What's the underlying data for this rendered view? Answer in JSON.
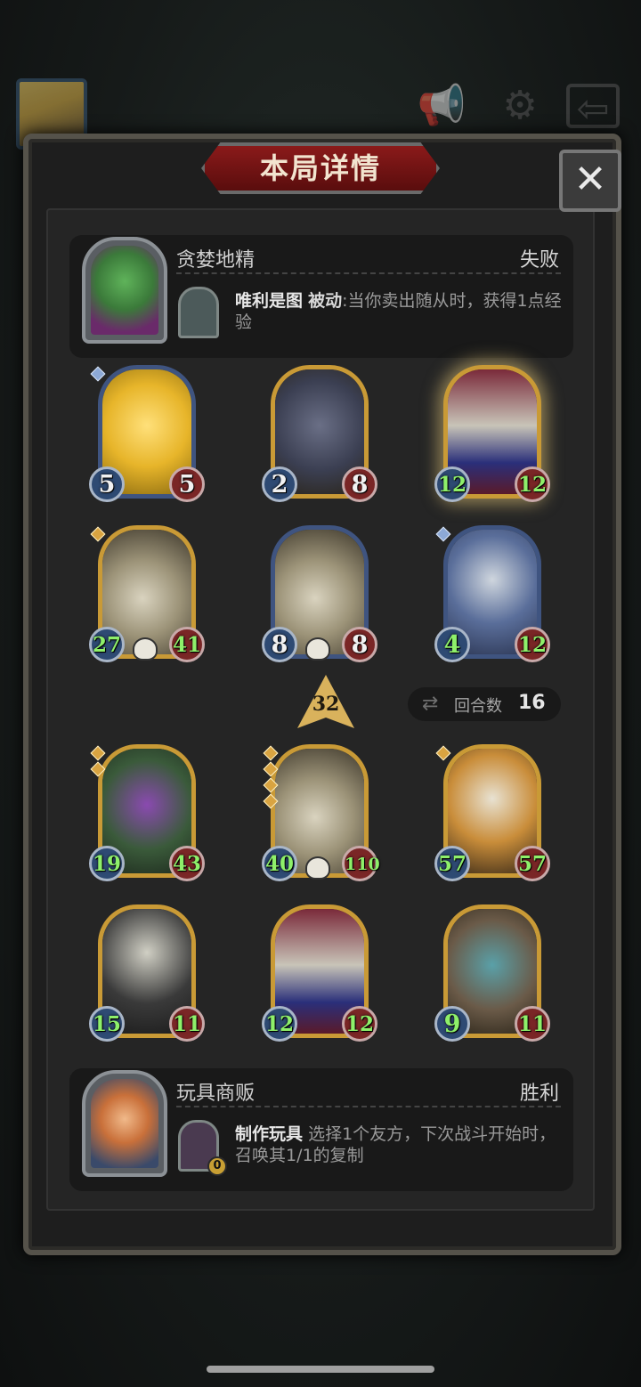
{
  "dialog": {
    "title": "本局详情",
    "close_label": "✕"
  },
  "opponent": {
    "name": "贪婪地精",
    "result": "失败",
    "skill_name": "唯利是图",
    "skill_type": "被动",
    "skill_desc": ":当你卖出随从时，获得1点经验"
  },
  "self": {
    "name": "玩具商贩",
    "result": "胜利",
    "skill_name": "制作玩具",
    "skill_desc": "选择1个友方，下次战斗开始时，召唤其1/1的复制",
    "skill_counter": "0"
  },
  "opponent_minions": [
    {
      "name": "golden-dragon",
      "atk": "5",
      "hp": "5",
      "frame": "blue",
      "art": "gold-dragon",
      "gems": 1,
      "gem_color": "blue",
      "skull": false,
      "glow": false
    },
    {
      "name": "rat",
      "atk": "2",
      "hp": "8",
      "frame": "gold",
      "art": "rat",
      "gems": 0,
      "skull": false,
      "glow": false
    },
    {
      "name": "clown",
      "atk": "12",
      "hp": "12",
      "frame": "gold",
      "art": "clown",
      "gems": 0,
      "skull": false,
      "glow": true
    },
    {
      "name": "bone-dragon",
      "atk": "27",
      "hp": "41",
      "frame": "gold",
      "art": "bone-dragon",
      "gems": 1,
      "gem_color": "gold",
      "skull": true,
      "glow": false
    },
    {
      "name": "bone-dragon",
      "atk": "8",
      "hp": "8",
      "frame": "blue",
      "art": "bone-dragon",
      "gems": 0,
      "skull": true,
      "glow": false
    },
    {
      "name": "knight",
      "atk": "4",
      "hp": "12",
      "frame": "blue",
      "art": "knight",
      "gems": 1,
      "gem_color": "blue",
      "skull": false,
      "glow": false
    }
  ],
  "self_minions": [
    {
      "name": "serpent-demon",
      "atk": "19",
      "hp": "43",
      "frame": "gold",
      "art": "serpent",
      "gems": 2,
      "gem_color": "gold",
      "skull": false,
      "glow": false
    },
    {
      "name": "bone-dragon",
      "atk": "40",
      "hp": "110",
      "frame": "gold",
      "art": "bone-dragon",
      "gems": 4,
      "gem_color": "gold",
      "skull": true,
      "glow": false
    },
    {
      "name": "pumpkin-mummy",
      "atk": "57",
      "hp": "57",
      "frame": "gold",
      "art": "pumpkin",
      "gems": 1,
      "gem_color": "gold",
      "skull": false,
      "glow": false
    },
    {
      "name": "reaper",
      "atk": "15",
      "hp": "11",
      "frame": "gold",
      "art": "reaper",
      "gems": 0,
      "skull": false,
      "glow": false
    },
    {
      "name": "clown",
      "atk": "12",
      "hp": "12",
      "frame": "gold",
      "art": "clown",
      "gems": 0,
      "skull": false,
      "glow": false
    },
    {
      "name": "horned-beast",
      "atk": "9",
      "hp": "11",
      "frame": "gold",
      "art": "beast",
      "gems": 0,
      "skull": false,
      "glow": false
    }
  ],
  "tier": {
    "value": "32"
  },
  "turns": {
    "label": "回合数",
    "value": "16"
  },
  "colors": {
    "panel": "#1e1e1e",
    "banner": "#8a1a1a",
    "stat_green": "#8ef06a",
    "frame_gold": "#a98434",
    "frame_blue": "#3f5480"
  }
}
